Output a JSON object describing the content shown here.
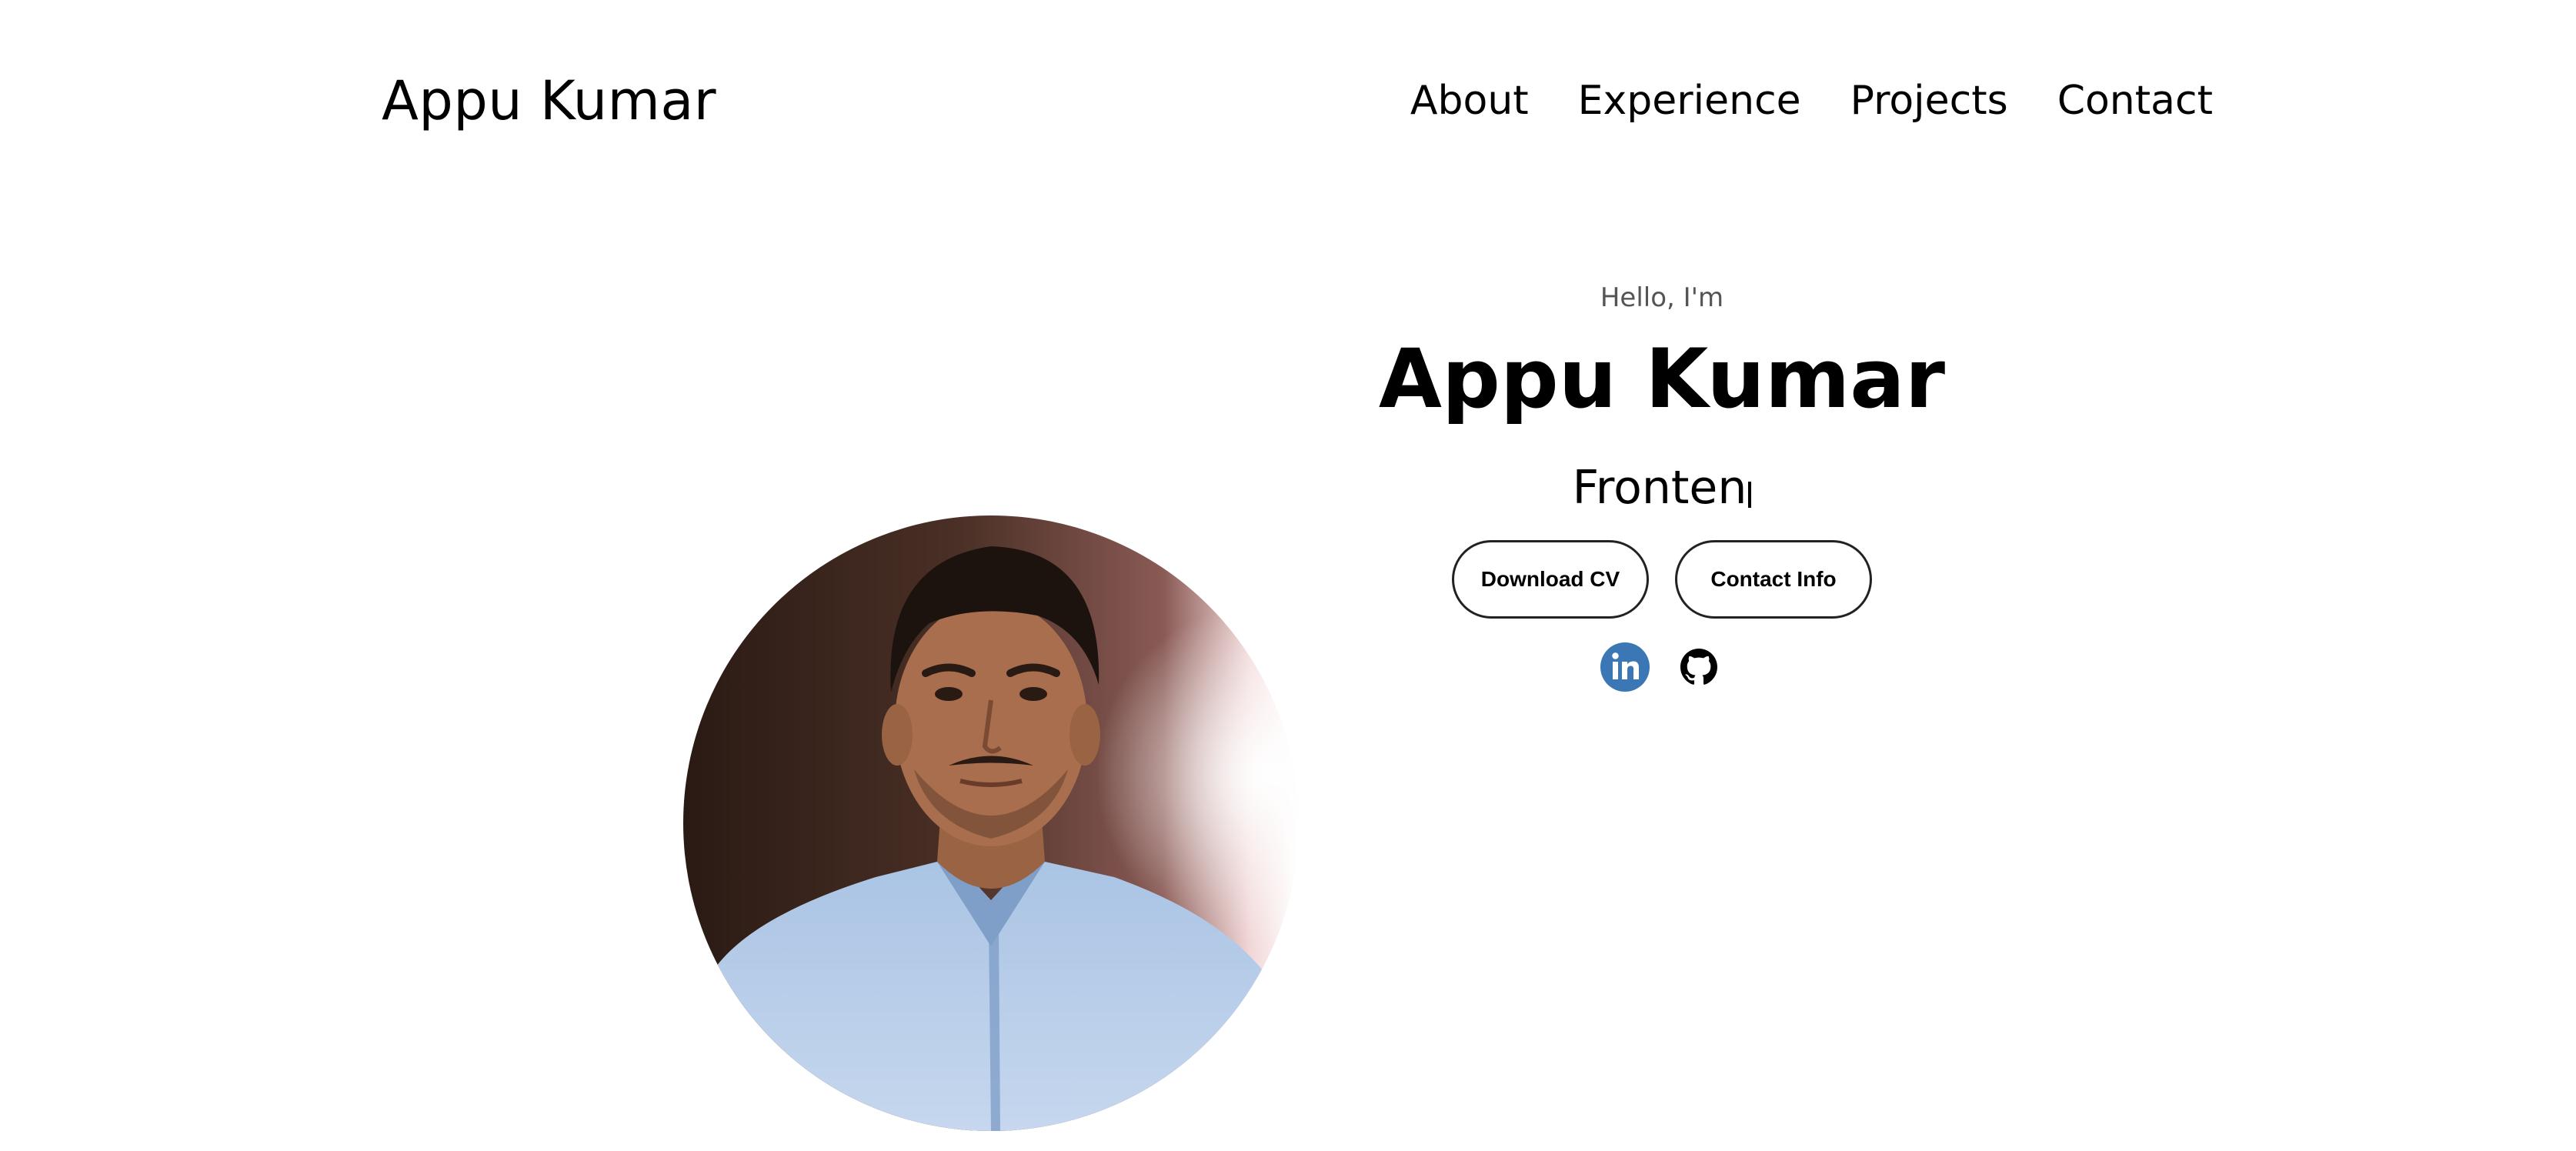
{
  "header": {
    "logo_text": "Appu Kumar",
    "nav": [
      {
        "label": "About"
      },
      {
        "label": "Experience"
      },
      {
        "label": "Projects"
      },
      {
        "label": "Contact"
      }
    ]
  },
  "hero": {
    "greeting": "Hello, I'm",
    "name": "Appu Kumar",
    "typed_role": "Fronten",
    "buttons": {
      "download_cv": "Download CV",
      "contact_info": "Contact Info"
    },
    "socials": [
      {
        "icon": "linkedin-icon",
        "color": "#3a77b4"
      },
      {
        "icon": "github-icon",
        "color": "#000000"
      }
    ],
    "profile_image": {
      "icon": "profile-photo"
    }
  },
  "colors": {
    "background": "#ffffff",
    "text": "#000000",
    "muted_text": "#555555",
    "linkedin_blue": "#3a77b4"
  }
}
